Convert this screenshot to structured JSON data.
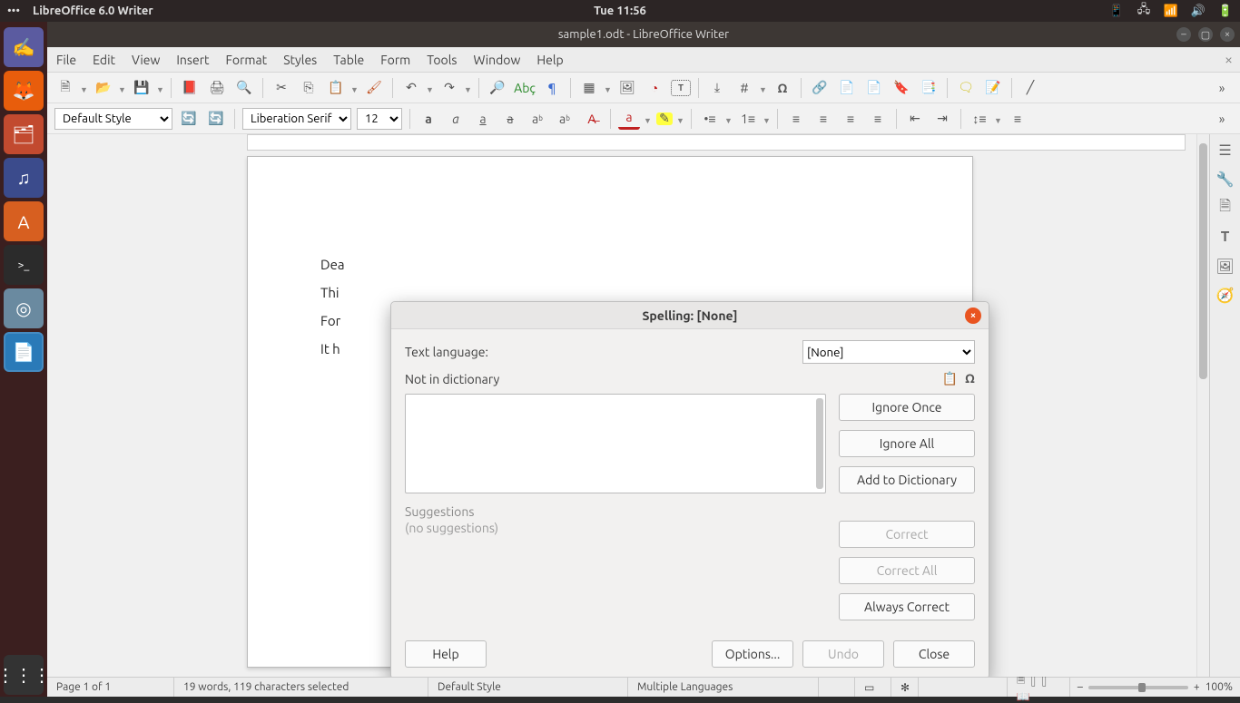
{
  "system": {
    "app_title": "LibreOffice 6.0 Writer",
    "clock": "Tue 11:56"
  },
  "launcher": {
    "items": [
      {
        "name": "search",
        "glyph": "✍",
        "bg": "#5b5ba0"
      },
      {
        "name": "firefox",
        "glyph": "🦊",
        "bg": "#e85d0c"
      },
      {
        "name": "files",
        "glyph": "📁",
        "bg": "#c24a2f"
      },
      {
        "name": "rhythmbox",
        "glyph": "🎵",
        "bg": "#3b4b8c"
      },
      {
        "name": "software",
        "glyph": "🛍",
        "bg": "#d75f20"
      },
      {
        "name": "terminal",
        "glyph": ">_",
        "bg": "#2b2b2b"
      },
      {
        "name": "chromium",
        "glyph": "◎",
        "bg": "#5a7a8c"
      },
      {
        "name": "writer",
        "glyph": "📄",
        "bg": "#1f6fb0",
        "active": true
      }
    ],
    "apps_glyph": "⋮⋮⋮"
  },
  "window": {
    "title": "sample1.odt - LibreOffice Writer"
  },
  "menubar": [
    "File",
    "Edit",
    "View",
    "Insert",
    "Format",
    "Styles",
    "Table",
    "Form",
    "Tools",
    "Window",
    "Help"
  ],
  "format_toolbar": {
    "para_style": "Default Style",
    "font_name": "Liberation Serif",
    "font_size": "12"
  },
  "document": {
    "lines": [
      "Dea",
      "Thi",
      "For",
      "It h"
    ]
  },
  "dialog": {
    "title": "Spelling: [None]",
    "text_language_label": "Text language:",
    "text_language_value": "[None]",
    "not_in_dict_label": "Not in dictionary",
    "suggestions_label": "Suggestions",
    "no_suggestions": "(no suggestions)",
    "buttons": {
      "ignore_once": "Ignore Once",
      "ignore_all": "Ignore All",
      "add_dict": "Add to Dictionary",
      "correct": "Correct",
      "correct_all": "Correct All",
      "always_correct": "Always Correct",
      "help": "Help",
      "options": "Options...",
      "undo": "Undo",
      "close": "Close"
    }
  },
  "statusbar": {
    "page": "Page 1 of 1",
    "words": "19 words, 119 characters selected",
    "style": "Default Style",
    "lang": "Multiple Languages",
    "zoom": "100%"
  }
}
